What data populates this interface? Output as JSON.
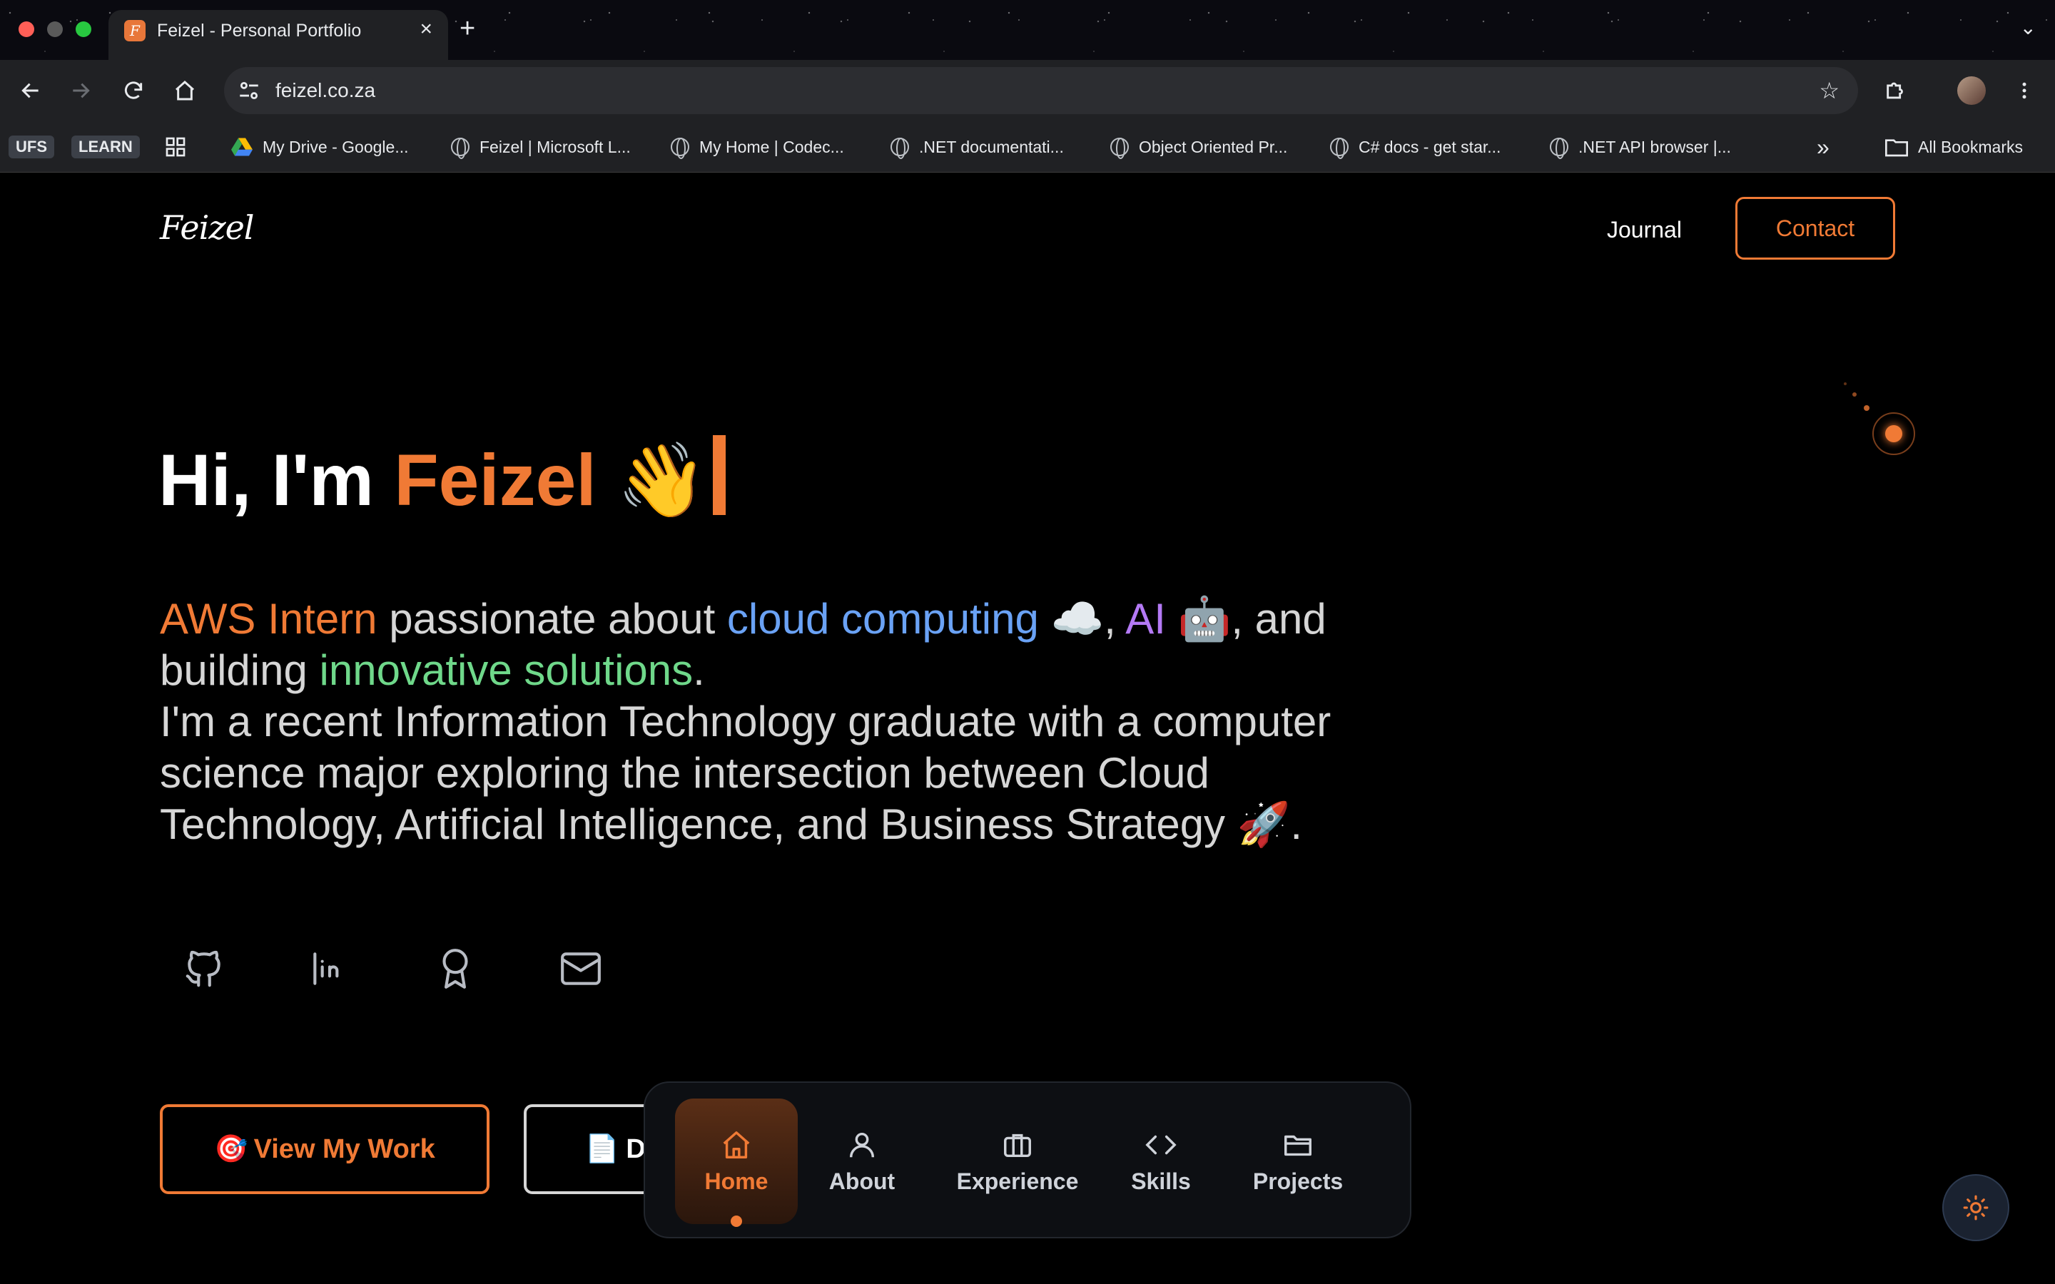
{
  "browser": {
    "tab_title": "Feizel - Personal Portfolio",
    "tab_favicon_letter": "F",
    "url": "feizel.co.za",
    "bookmarks": [
      {
        "label": "UFS",
        "type": "badge"
      },
      {
        "label": "LEARN",
        "type": "badge"
      },
      {
        "label": "My Drive - Google...",
        "type": "drive"
      },
      {
        "label": "Feizel | Microsoft L...",
        "type": "globe"
      },
      {
        "label": "My Home | Codec...",
        "type": "globe"
      },
      {
        "label": ".NET documentati...",
        "type": "globe"
      },
      {
        "label": "Object Oriented Pr...",
        "type": "globe"
      },
      {
        "label": "C# docs - get star...",
        "type": "globe"
      },
      {
        "label": ".NET API browser |...",
        "type": "globe"
      }
    ],
    "all_bookmarks_label": "All Bookmarks",
    "overflow_label": "»"
  },
  "site": {
    "logo": "Feizel",
    "nav": {
      "journal": "Journal",
      "contact": "Contact"
    },
    "hero": {
      "greeting": "Hi, I'm ",
      "name": "Feizel",
      "wave": "👋"
    },
    "intro": {
      "role": "AWS Intern",
      "t1": " passionate about ",
      "cloud": "cloud computing",
      "cloud_emoji": " ☁️, ",
      "ai": "AI",
      "ai_emoji": " 🤖, and building ",
      "innov": "innovative solutions",
      "t2": ".",
      "para2": "I'm a recent Information Technology graduate with a computer science major exploring the intersection between Cloud Technology, Artificial Intelligence, and Business Strategy 🚀."
    },
    "social": [
      "github-icon",
      "linkedin-icon",
      "award-icon",
      "mail-icon"
    ],
    "buttons": {
      "view_work": "View My Work",
      "view_work_emoji": "🎯",
      "download": "Do",
      "download_emoji": "📄"
    },
    "dock": [
      {
        "label": "Home",
        "icon": "home-icon",
        "active": true
      },
      {
        "label": "About",
        "icon": "user-icon"
      },
      {
        "label": "Experience",
        "icon": "briefcase-icon"
      },
      {
        "label": "Skills",
        "icon": "code-icon"
      },
      {
        "label": "Projects",
        "icon": "folder-icon"
      }
    ]
  },
  "colors": {
    "accent": "#f07a35",
    "cloud": "#6aa2f5",
    "ai": "#b47af5",
    "innovative": "#6fd88a",
    "background": "#000000"
  }
}
